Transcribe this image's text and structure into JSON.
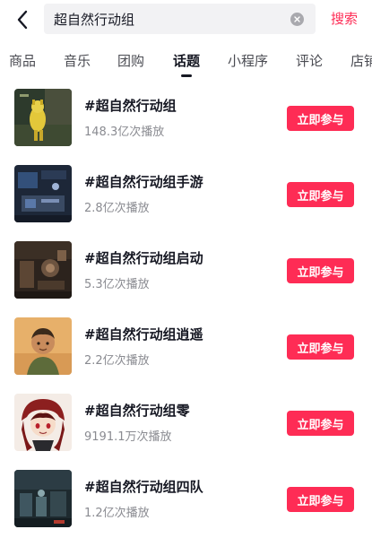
{
  "search": {
    "query": "超自然行动组",
    "submit_label": "搜索"
  },
  "tabs": [
    {
      "label": "商品"
    },
    {
      "label": "音乐"
    },
    {
      "label": "团购"
    },
    {
      "label": "话题",
      "active": true
    },
    {
      "label": "小程序"
    },
    {
      "label": "评论"
    },
    {
      "label": "店铺"
    }
  ],
  "topics": [
    {
      "title": "#超自然行动组",
      "plays": "148.3亿次播放",
      "action": "立即参与"
    },
    {
      "title": "#超自然行动组手游",
      "plays": "2.8亿次播放",
      "action": "立即参与"
    },
    {
      "title": "#超自然行动组启动",
      "plays": "5.3亿次播放",
      "action": "立即参与"
    },
    {
      "title": "#超自然行动组逍遥",
      "plays": "2.2亿次播放",
      "action": "立即参与"
    },
    {
      "title": "#超自然行动组零",
      "plays": "9191.1万次播放",
      "action": "立即参与"
    },
    {
      "title": "#超自然行动组四队",
      "plays": "1.2亿次播放",
      "action": "立即参与"
    }
  ],
  "colors": {
    "accent": "#fe2c55",
    "text_primary": "#161823",
    "text_secondary": "#8a8b91"
  }
}
